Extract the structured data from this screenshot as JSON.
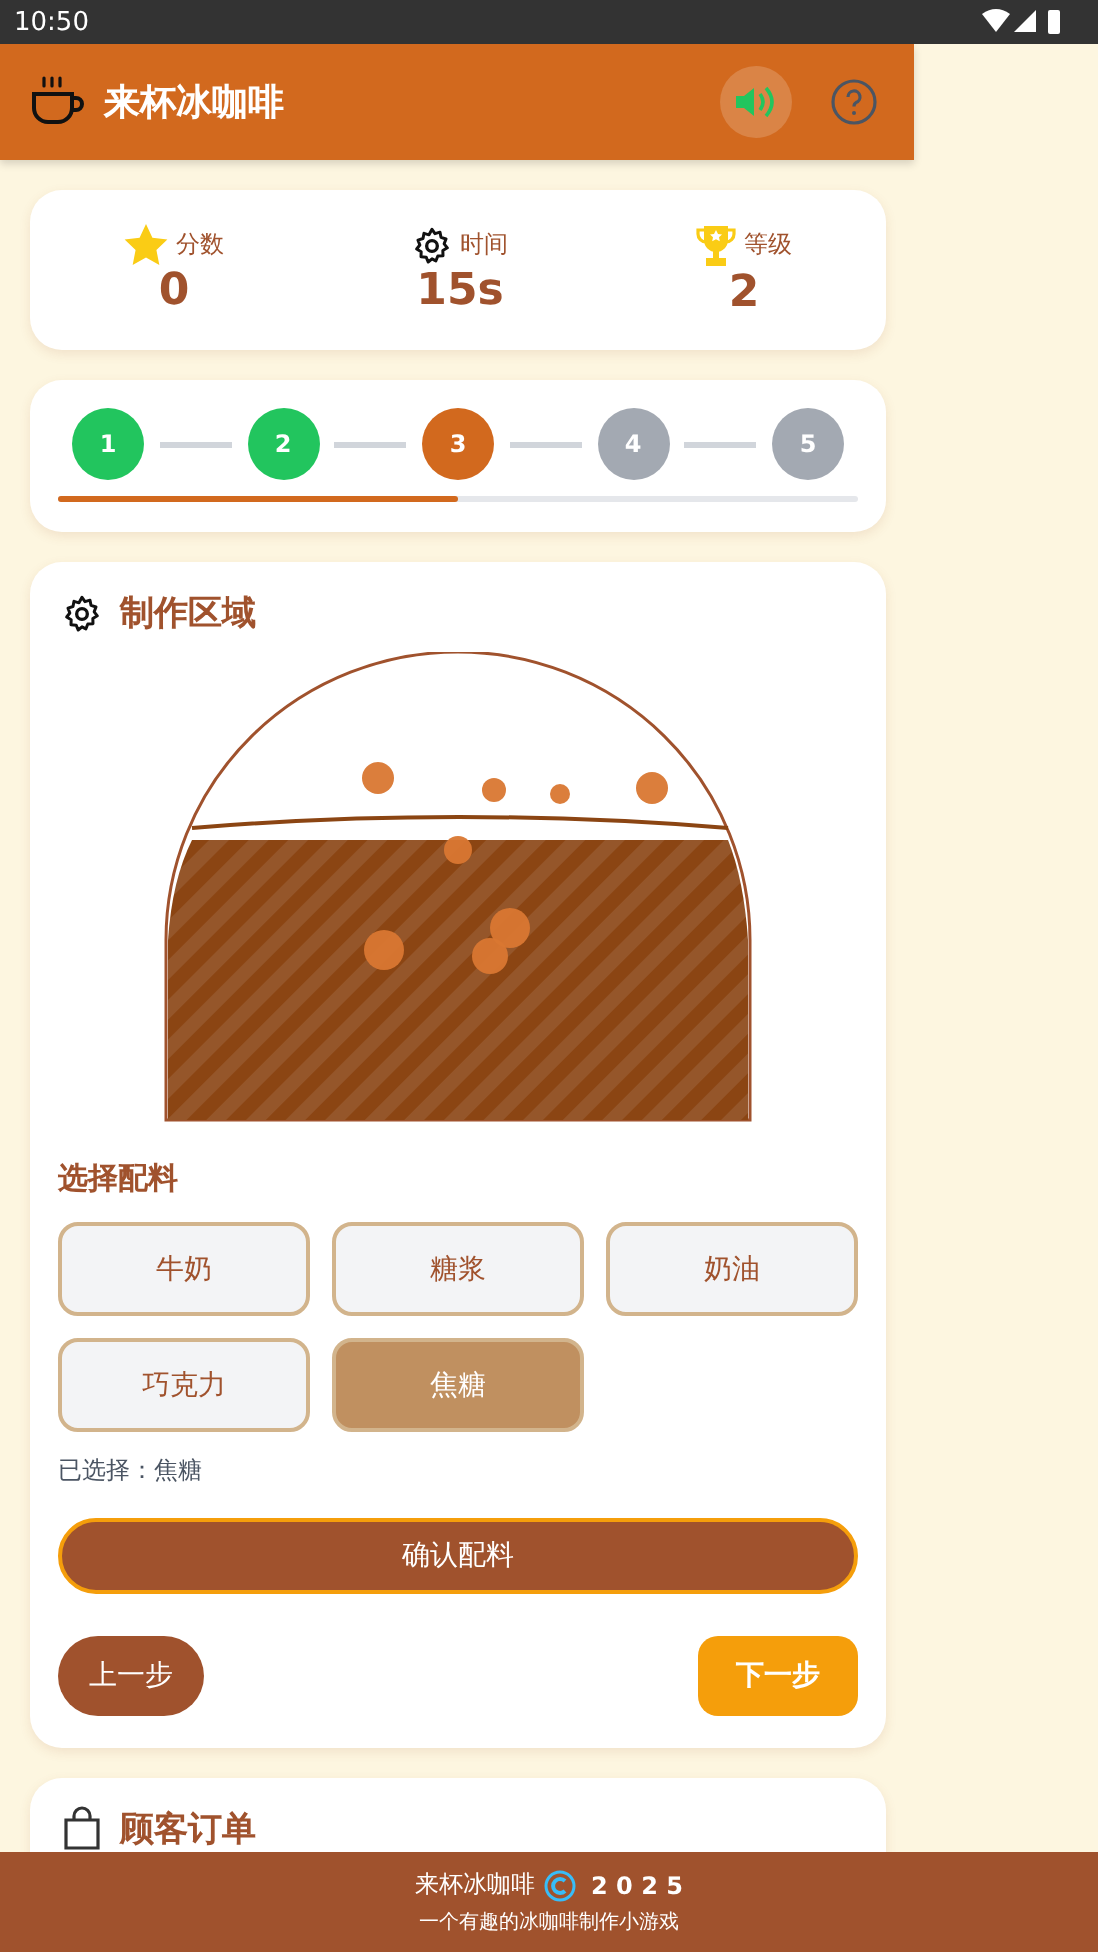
{
  "status_bar": {
    "time": "10:50"
  },
  "app_bar": {
    "title": "来杯冰咖啡",
    "sound_on": true
  },
  "stats": [
    {
      "kind": "score",
      "label": "分数",
      "value": "0"
    },
    {
      "kind": "time",
      "label": "时间",
      "value": "15s"
    },
    {
      "kind": "level",
      "label": "等级",
      "value": "2"
    }
  ],
  "steps": [
    {
      "label": "1",
      "completed": true,
      "active": false
    },
    {
      "label": "2",
      "completed": true,
      "active": false
    },
    {
      "label": "3",
      "completed": false,
      "active": true
    },
    {
      "label": "4",
      "completed": false,
      "active": false
    },
    {
      "label": "5",
      "completed": false,
      "active": false
    }
  ],
  "progress": {
    "level": 0.5
  },
  "workspace": {
    "title": "制作区域",
    "ingredients_heading": "选择配料",
    "ingredients": [
      {
        "label": "牛奶",
        "selected": false
      },
      {
        "label": "糖浆",
        "selected": false
      },
      {
        "label": "奶油",
        "selected": false
      },
      {
        "label": "巧克力",
        "selected": false
      },
      {
        "label": "焦糖",
        "selected": true
      }
    ],
    "selection_text": "已选择：焦糖",
    "confirm_button": "确认配料",
    "prev_button": "上一步",
    "next_button": "下一步"
  },
  "orders": {
    "title": "顾客订单"
  },
  "footer": {
    "brand": "来杯冰咖啡",
    "year": "2 0 2 5",
    "tagline": "一个有趣的冰咖啡制作小游戏"
  }
}
